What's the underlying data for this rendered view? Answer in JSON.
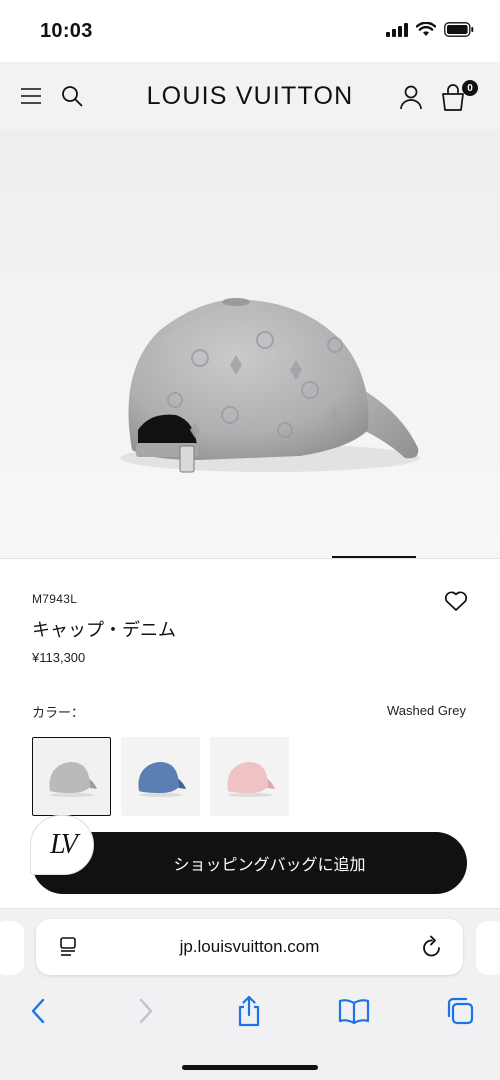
{
  "status_bar": {
    "time": "10:03"
  },
  "header": {
    "brand": "LOUIS VUITTON",
    "bag_count": "0"
  },
  "product": {
    "sku": "M7943L",
    "name": "キャップ・デニム",
    "price": "¥113,300",
    "color_label": "カラー：",
    "color_value": "Washed Grey",
    "swatches": [
      {
        "name": "Washed Grey",
        "color": "#b9babc",
        "selected": true
      },
      {
        "name": "Blue",
        "color": "#5a7fb0",
        "selected": false
      },
      {
        "name": "Pink",
        "color": "#efc2c4",
        "selected": false
      }
    ],
    "add_to_bag_label": "ショッピングバッグに追加"
  },
  "browser": {
    "url": "jp.louisvuitton.com"
  },
  "colors": {
    "accent": "#111111",
    "image_bg": "#eeeeee"
  }
}
